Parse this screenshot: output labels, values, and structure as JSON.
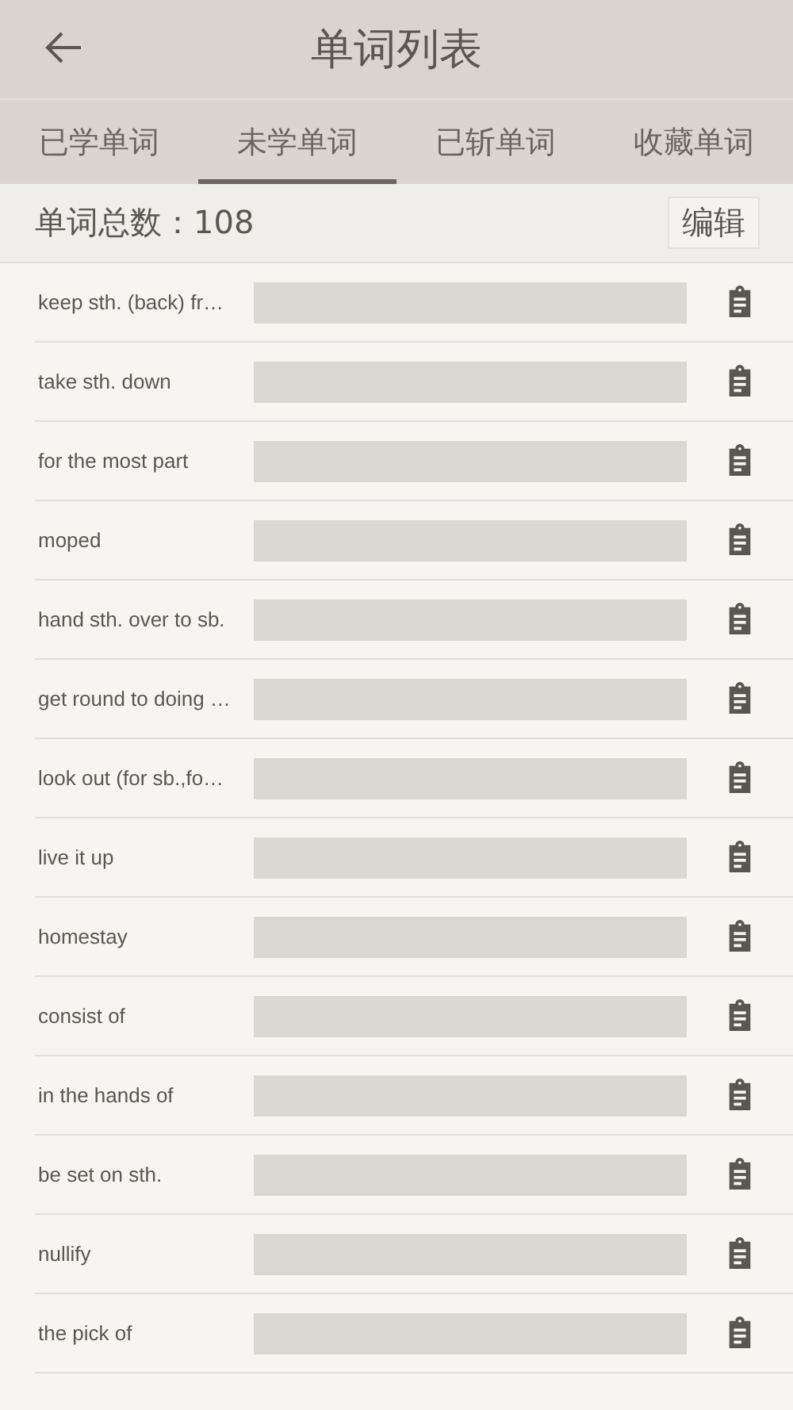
{
  "header": {
    "title": "单词列表"
  },
  "tabs": [
    {
      "label": "已学单词",
      "selected": false
    },
    {
      "label": "未学单词",
      "selected": true
    },
    {
      "label": "已斩单词",
      "selected": false
    },
    {
      "label": "收藏单词",
      "selected": false
    }
  ],
  "summary": {
    "count_label": "单词总数：108",
    "edit_button": "编辑"
  },
  "words": [
    {
      "word": "keep sth. (back) fr…"
    },
    {
      "word": "take sth. down"
    },
    {
      "word": "for the most part"
    },
    {
      "word": "moped"
    },
    {
      "word": "hand sth. over to sb."
    },
    {
      "word": "get round to doing …"
    },
    {
      "word": "look out (for sb.,fo…"
    },
    {
      "word": "live it up"
    },
    {
      "word": "homestay"
    },
    {
      "word": "consist of"
    },
    {
      "word": "in the hands of"
    },
    {
      "word": "be set on sth."
    },
    {
      "word": "nullify"
    },
    {
      "word": "the pick of"
    }
  ]
}
